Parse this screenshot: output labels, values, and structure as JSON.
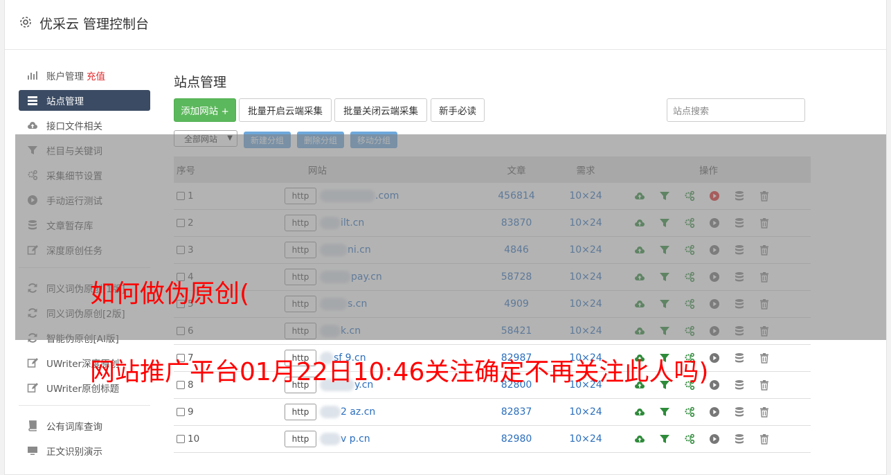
{
  "header": {
    "title": "优采云 管理控制台"
  },
  "sidebar": {
    "items": [
      {
        "label": "账户管理",
        "extra": "充值",
        "icon": "bar-chart-icon"
      },
      {
        "label": "站点管理",
        "icon": "server-icon",
        "active": true
      },
      {
        "label": "接口文件相关",
        "icon": "cloud-upload-icon"
      },
      {
        "label": "栏目与关键词",
        "icon": "filter-icon"
      },
      {
        "label": "采集细节设置",
        "icon": "gears-icon"
      },
      {
        "label": "手动运行测试",
        "icon": "play-icon"
      },
      {
        "label": "文章暂存库",
        "icon": "database-icon"
      },
      {
        "label": "深度原创任务",
        "icon": "edit-icon"
      },
      {
        "label": "同义词伪原创[1版]",
        "icon": "refresh-icon"
      },
      {
        "label": "同义词伪原创[2版]",
        "icon": "refresh-icon"
      },
      {
        "label": "智能伪原创[AI版]",
        "icon": "refresh-icon"
      },
      {
        "label": "UWriter深度原创",
        "icon": "edit-icon"
      },
      {
        "label": "UWriter原创标题",
        "icon": "edit-icon"
      },
      {
        "label": "公有词库查询",
        "icon": "book-icon"
      },
      {
        "label": "正文识别演示",
        "icon": "monitor-icon"
      }
    ]
  },
  "main": {
    "title": "站点管理",
    "toolbar": {
      "add_site": "添加网站 +",
      "batch_open": "批量开启云端采集",
      "batch_close": "批量关闭云端采集",
      "newbie": "新手必读"
    },
    "search_placeholder": "站点搜索",
    "group_select": "全部网站",
    "group_buttons": {
      "new": "新建分组",
      "delete": "删除分组",
      "move": "移动分组"
    },
    "table": {
      "headers": {
        "no": "序号",
        "site": "网站",
        "articles": "文章",
        "demand": "需求",
        "ops": "操作"
      },
      "http_label": "http",
      "rows": [
        {
          "no": "1",
          "site": "v .com",
          "site_suffix": ".com",
          "articles": "456814",
          "demand": "10×24",
          "run_active": true
        },
        {
          "no": "2",
          "site_suffix": "ilt.cn",
          "articles": "83870",
          "demand": "10×24",
          "run_active": false
        },
        {
          "no": "3",
          "site_suffix": "ni.cn",
          "articles": "4846",
          "demand": "10×24",
          "run_active": false
        },
        {
          "no": "4",
          "site_suffix": "pay.cn",
          "articles": "58728",
          "demand": "10×24",
          "run_active": false
        },
        {
          "no": "5",
          "site_suffix": "s.cn",
          "articles": "4909",
          "demand": "10×24",
          "run_active": false
        },
        {
          "no": "6",
          "site_suffix": "k.cn",
          "articles": "58421",
          "demand": "10×24",
          "run_active": false
        },
        {
          "no": "7",
          "site_suffix": "sf 9.cn",
          "articles": "82987",
          "demand": "10×24",
          "run_active": false
        },
        {
          "no": "8",
          "site_suffix": "y.cn",
          "articles": "82800",
          "demand": "10×24",
          "run_active": false
        },
        {
          "no": "9",
          "site_suffix": "2 az.cn",
          "articles": "82837",
          "demand": "10×24",
          "run_active": false
        },
        {
          "no": "10",
          "site_suffix": "v p.cn",
          "articles": "82980",
          "demand": "10×24",
          "run_active": false
        }
      ]
    }
  },
  "watermark": {
    "line1": "如何做伪原创(",
    "line2": "网站推广平台01月22日10:46关注确定不再关注此人吗)"
  },
  "colors": {
    "accent_green": "#5cb85c",
    "sidebar_active": "#3b4b63",
    "link_blue": "#2a6ebd",
    "watermark_red": "#ff0000"
  }
}
